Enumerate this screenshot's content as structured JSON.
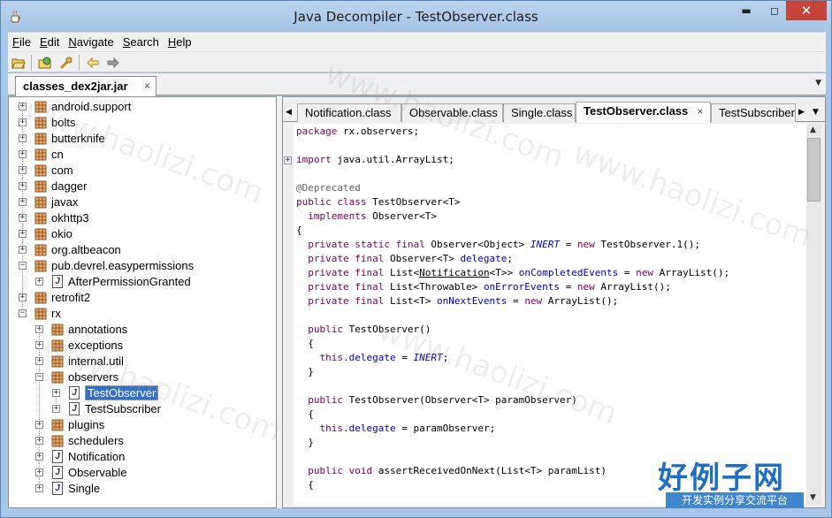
{
  "window": {
    "title": "Java Decompiler - TestObserver.class",
    "min_glyph": "▬",
    "max_glyph": "◻",
    "close_glyph": "✕"
  },
  "menu": [
    "File",
    "Edit",
    "Navigate",
    "Search",
    "Help"
  ],
  "menu_mnemonics": [
    "F",
    "E",
    "N",
    "S",
    "H"
  ],
  "file_tab": {
    "label": "classes_dex2jar.jar",
    "close": "×"
  },
  "tree": [
    {
      "label": "android.support",
      "depth": 0,
      "type": "package",
      "state": "collapsed"
    },
    {
      "label": "bolts",
      "depth": 0,
      "type": "package",
      "state": "collapsed"
    },
    {
      "label": "butterknife",
      "depth": 0,
      "type": "package",
      "state": "collapsed"
    },
    {
      "label": "cn",
      "depth": 0,
      "type": "package",
      "state": "collapsed"
    },
    {
      "label": "com",
      "depth": 0,
      "type": "package",
      "state": "collapsed"
    },
    {
      "label": "dagger",
      "depth": 0,
      "type": "package",
      "state": "collapsed"
    },
    {
      "label": "javax",
      "depth": 0,
      "type": "package",
      "state": "collapsed"
    },
    {
      "label": "okhttp3",
      "depth": 0,
      "type": "package",
      "state": "collapsed"
    },
    {
      "label": "okio",
      "depth": 0,
      "type": "package",
      "state": "collapsed"
    },
    {
      "label": "org.altbeacon",
      "depth": 0,
      "type": "package",
      "state": "collapsed"
    },
    {
      "label": "pub.devrel.easypermissions",
      "depth": 0,
      "type": "package",
      "state": "expanded"
    },
    {
      "label": "AfterPermissionGranted",
      "depth": 1,
      "type": "class",
      "state": "collapsed"
    },
    {
      "label": "retrofit2",
      "depth": 0,
      "type": "package",
      "state": "collapsed"
    },
    {
      "label": "rx",
      "depth": 0,
      "type": "package",
      "state": "expanded"
    },
    {
      "label": "annotations",
      "depth": 1,
      "type": "package",
      "state": "collapsed"
    },
    {
      "label": "exceptions",
      "depth": 1,
      "type": "package",
      "state": "collapsed"
    },
    {
      "label": "internal.util",
      "depth": 1,
      "type": "package",
      "state": "collapsed"
    },
    {
      "label": "observers",
      "depth": 1,
      "type": "package",
      "state": "expanded"
    },
    {
      "label": "TestObserver",
      "depth": 2,
      "type": "class",
      "state": "collapsed",
      "selected": true
    },
    {
      "label": "TestSubscriber",
      "depth": 2,
      "type": "class",
      "state": "collapsed"
    },
    {
      "label": "plugins",
      "depth": 1,
      "type": "package",
      "state": "collapsed"
    },
    {
      "label": "schedulers",
      "depth": 1,
      "type": "package",
      "state": "collapsed"
    },
    {
      "label": "Notification",
      "depth": 1,
      "type": "class",
      "state": "collapsed"
    },
    {
      "label": "Observable",
      "depth": 1,
      "type": "class",
      "state": "collapsed"
    },
    {
      "label": "Single",
      "depth": 1,
      "type": "class",
      "state": "collapsed"
    }
  ],
  "code_tabs": [
    {
      "label": "Notification.class",
      "active": false
    },
    {
      "label": "Observable.class",
      "active": false
    },
    {
      "label": "Single.class",
      "active": false
    },
    {
      "label": "TestObserver.class",
      "active": true,
      "close": "×"
    },
    {
      "label": "TestSubscriber.c",
      "active": false
    }
  ],
  "code_lines": [
    [
      {
        "t": "package",
        "c": "kw"
      },
      {
        "t": " rx.observers;"
      }
    ],
    [],
    [
      {
        "t": "import",
        "c": "kw"
      },
      {
        "t": " java.util.ArrayList;"
      }
    ],
    [],
    [
      {
        "t": "@Deprecated",
        "c": "ann"
      }
    ],
    [
      {
        "t": "public class",
        "c": "kw"
      },
      {
        "t": " TestObserver<T>"
      }
    ],
    [
      {
        "t": "  "
      },
      {
        "t": "implements",
        "c": "kw"
      },
      {
        "t": " Observer<T>"
      }
    ],
    [
      {
        "t": "{"
      }
    ],
    [
      {
        "t": "  "
      },
      {
        "t": "private static final",
        "c": "kw"
      },
      {
        "t": " Observer<Object> "
      },
      {
        "t": "INERT",
        "c": "sfld"
      },
      {
        "t": " = "
      },
      {
        "t": "new",
        "c": "kw"
      },
      {
        "t": " TestObserver.1();"
      }
    ],
    [
      {
        "t": "  "
      },
      {
        "t": "private final",
        "c": "kw"
      },
      {
        "t": " Observer<T> "
      },
      {
        "t": "delegate",
        "c": "fld"
      },
      {
        "t": ";"
      }
    ],
    [
      {
        "t": "  "
      },
      {
        "t": "private final",
        "c": "kw"
      },
      {
        "t": " List<"
      },
      {
        "t": "Notification",
        "c": "lnk"
      },
      {
        "t": "<T>> "
      },
      {
        "t": "onCompletedEvents",
        "c": "fld"
      },
      {
        "t": " = "
      },
      {
        "t": "new",
        "c": "kw"
      },
      {
        "t": " ArrayList();"
      }
    ],
    [
      {
        "t": "  "
      },
      {
        "t": "private final",
        "c": "kw"
      },
      {
        "t": " List<Throwable> "
      },
      {
        "t": "onErrorEvents",
        "c": "fld"
      },
      {
        "t": " = "
      },
      {
        "t": "new",
        "c": "kw"
      },
      {
        "t": " ArrayList();"
      }
    ],
    [
      {
        "t": "  "
      },
      {
        "t": "private final",
        "c": "kw"
      },
      {
        "t": " List<T> "
      },
      {
        "t": "onNextEvents",
        "c": "fld"
      },
      {
        "t": " = "
      },
      {
        "t": "new",
        "c": "kw"
      },
      {
        "t": " ArrayList();"
      }
    ],
    [],
    [
      {
        "t": "  "
      },
      {
        "t": "public",
        "c": "kw"
      },
      {
        "t": " TestObserver()"
      }
    ],
    [
      {
        "t": "  {"
      }
    ],
    [
      {
        "t": "    "
      },
      {
        "t": "this",
        "c": "kw"
      },
      {
        "t": "."
      },
      {
        "t": "delegate",
        "c": "fld"
      },
      {
        "t": " = "
      },
      {
        "t": "INERT",
        "c": "sfld"
      },
      {
        "t": ";"
      }
    ],
    [
      {
        "t": "  }"
      }
    ],
    [],
    [
      {
        "t": "  "
      },
      {
        "t": "public",
        "c": "kw"
      },
      {
        "t": " TestObserver(Observer<T> paramObserver)"
      }
    ],
    [
      {
        "t": "  {"
      }
    ],
    [
      {
        "t": "    "
      },
      {
        "t": "this",
        "c": "kw"
      },
      {
        "t": "."
      },
      {
        "t": "delegate",
        "c": "fld"
      },
      {
        "t": " = paramObserver;"
      }
    ],
    [
      {
        "t": "  }"
      }
    ],
    [],
    [
      {
        "t": "  "
      },
      {
        "t": "public void",
        "c": "kw"
      },
      {
        "t": " assertReceivedOnNext(List<T> paramList)"
      }
    ],
    [
      {
        "t": "  {"
      }
    ]
  ],
  "fold_markers": [
    {
      "line": 2,
      "glyph": "+"
    }
  ],
  "watermark": {
    "big": "好例子网",
    "small": "开发实例分享交流平台",
    "diag": "www.haolizi.com"
  }
}
